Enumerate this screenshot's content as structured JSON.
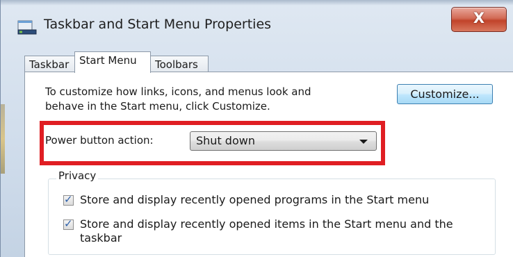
{
  "window": {
    "title": "Taskbar and Start Menu Properties",
    "icons": {
      "app": "taskbar-properties-icon",
      "close": "close-icon"
    },
    "close_glyph": "X"
  },
  "tabs": [
    {
      "label": "Taskbar",
      "active": false
    },
    {
      "label": "Start Menu",
      "active": true
    },
    {
      "label": "Toolbars",
      "active": false
    }
  ],
  "start_menu": {
    "description_line1": "To customize how links, icons, and menus look and",
    "description_line2": "behave in the Start menu, click Customize.",
    "customize_label": "Customize...",
    "power_label": "Power button action:",
    "power_value": "Shut down",
    "privacy": {
      "legend": "Privacy",
      "options": [
        {
          "label_line1": "Store and display recently opened programs in the Start menu",
          "label_line2": "",
          "checked": true
        },
        {
          "label_line1": "Store and display recently opened items in the Start menu and the",
          "label_line2": "taskbar",
          "checked": true
        }
      ]
    }
  },
  "colors": {
    "highlight": "#e01e23",
    "close_button": "#c1432a",
    "checkmark": "#2b5ea8"
  }
}
